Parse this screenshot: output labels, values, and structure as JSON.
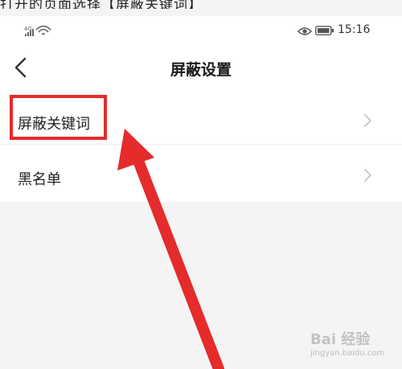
{
  "caption": {
    "text": "打开的页面选择【屏蔽关键词】"
  },
  "status_bar": {
    "signal_text": "4G",
    "time": "15:16"
  },
  "nav": {
    "title": "屏蔽设置"
  },
  "list": {
    "items": [
      {
        "label": "屏蔽关键词"
      },
      {
        "label": "黑名单"
      }
    ]
  },
  "watermark": {
    "brand": "Bai 经验",
    "url": "jingyan.baidu.com"
  },
  "colors": {
    "accent": "#e52b2b",
    "background": "#f4f4f4",
    "surface": "#ffffff"
  }
}
